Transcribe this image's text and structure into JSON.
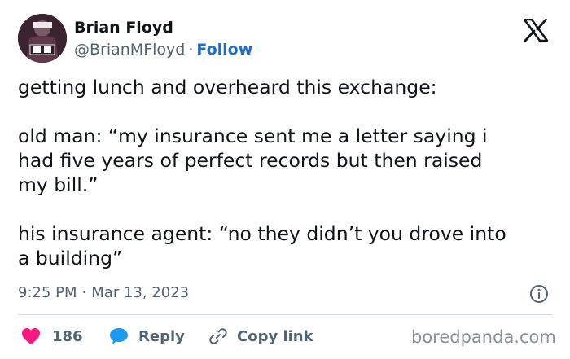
{
  "author": {
    "name": "Brian Floyd",
    "handle": "@BrianMFloyd",
    "separator": "·",
    "follow_label": "Follow"
  },
  "tweet": {
    "lines": [
      "getting lunch and overheard this exchange:",
      "",
      "old man: “my insurance sent me a letter saying i",
      "had five years of perfect records but then raised",
      "my bill.”",
      "",
      "his insurance agent: “no they didn’t you drove into",
      "a building”"
    ]
  },
  "meta": {
    "time": "9:25 PM",
    "separator": "·",
    "date": "Mar 13, 2023"
  },
  "actions": {
    "like_count": "186",
    "reply_label": "Reply",
    "copy_label": "Copy link"
  },
  "watermark": "boredpanda.com",
  "colors": {
    "like": "#f91880",
    "reply": "#1d9bf0",
    "follow": "#1d6fc9",
    "muted": "#536471"
  },
  "icons": {
    "logo": "x-logo-icon",
    "info": "info-icon",
    "like": "heart-icon",
    "reply": "speech-bubble-icon",
    "copy": "link-icon"
  }
}
